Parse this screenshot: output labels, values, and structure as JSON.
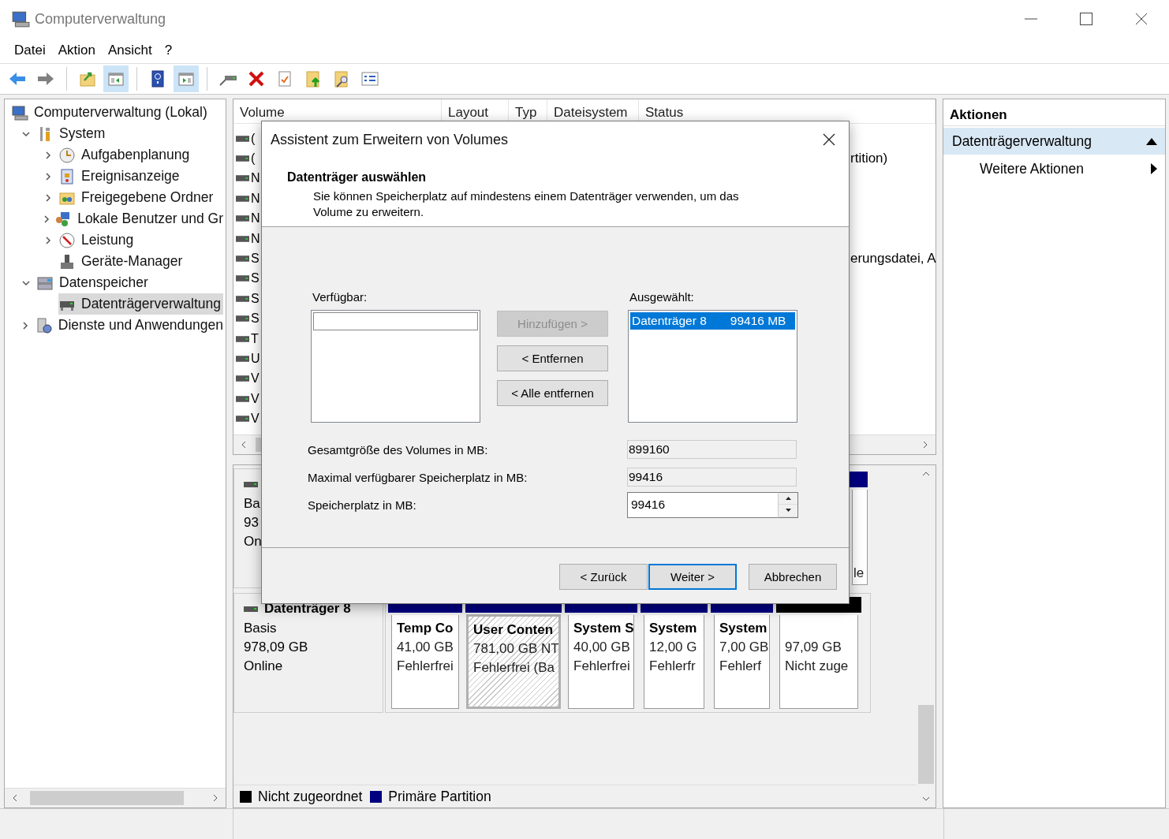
{
  "window": {
    "title": "Computerverwaltung"
  },
  "menu": [
    {
      "label": "Datei"
    },
    {
      "label": "Aktion"
    },
    {
      "label": "Ansicht"
    },
    {
      "label": "?"
    }
  ],
  "toolbar": [
    {
      "pressed": false
    },
    {
      "pressed": false
    },
    {
      "pressed": false
    },
    {
      "pressed": true
    },
    {
      "pressed": false
    },
    {
      "pressed": true
    },
    {
      "pressed": false
    },
    {
      "pressed": false
    },
    {
      "pressed": false
    },
    {
      "pressed": false
    },
    {
      "pressed": false
    },
    {
      "pressed": false
    }
  ],
  "tree": [
    {
      "label": "Computerverwaltung (Lokal)",
      "selected": false,
      "children": [
        {
          "label": "System",
          "expandable": true,
          "expanded": true,
          "selected": false,
          "children": [
            {
              "label": "Aufgabenplanung",
              "expandable": true,
              "expanded": false,
              "selected": false
            },
            {
              "label": "Ereignisanzeige",
              "expandable": true,
              "expanded": false,
              "selected": false
            },
            {
              "label": "Freigegebene Ordner",
              "expandable": true,
              "expanded": false,
              "selected": false
            },
            {
              "label": "Lokale Benutzer und Gr",
              "expandable": true,
              "expanded": false,
              "selected": false
            },
            {
              "label": "Leistung",
              "expandable": true,
              "expanded": false,
              "selected": false
            },
            {
              "label": "Geräte-Manager",
              "expandable": false,
              "selected": false
            }
          ]
        },
        {
          "label": "Datenspeicher",
          "expandable": true,
          "expanded": true,
          "selected": false,
          "children": [
            {
              "label": "Datenträgerverwaltung",
              "expandable": false,
              "selected": true
            }
          ]
        },
        {
          "label": "Dienste und Anwendungen",
          "expandable": true,
          "expanded": false,
          "selected": false
        }
      ]
    }
  ],
  "volume_list": {
    "columns": [
      "Volume",
      "Layout",
      "Typ",
      "Dateisystem",
      "Status"
    ],
    "rows": [
      {
        "volume": "("
      },
      {
        "volume": "(",
        "status": "rtition)"
      },
      {
        "volume": "N"
      },
      {
        "volume": "N"
      },
      {
        "volume": "N"
      },
      {
        "volume": "N"
      },
      {
        "volume": "S",
        "status": "erungsdatei, A"
      },
      {
        "volume": "S"
      },
      {
        "volume": "S"
      },
      {
        "volume": "S"
      },
      {
        "volume": "T"
      },
      {
        "volume": "U"
      },
      {
        "volume": "V"
      },
      {
        "volume": "V"
      },
      {
        "volume": "V"
      }
    ]
  },
  "disks": [
    {
      "info": [
        "Ba",
        "93",
        "On"
      ],
      "partitions": [
        {
          "color": "#000080",
          "selected": false,
          "lines": [
            "le"
          ]
        }
      ]
    },
    {
      "name": "Datenträger 8",
      "info": [
        "Basis",
        "978,09 GB",
        "Online"
      ],
      "partitions": [
        {
          "color": "#000080",
          "selected": false,
          "name": "Temp Co",
          "lines": [
            "41,00 GB",
            "Fehlerfrei"
          ]
        },
        {
          "color": "#000080",
          "selected": true,
          "name": "User Conten",
          "lines": [
            "781,00 GB NT",
            "Fehlerfrei (Ba"
          ]
        },
        {
          "color": "#000080",
          "selected": false,
          "name": "System S",
          "lines": [
            "40,00 GB",
            "Fehlerfrei"
          ]
        },
        {
          "color": "#000080",
          "selected": false,
          "name": "System",
          "lines": [
            "12,00 G",
            "Fehlerfr"
          ]
        },
        {
          "color": "#000080",
          "selected": false,
          "name": "System",
          "lines": [
            "7,00 GB",
            "Fehlerf"
          ]
        },
        {
          "color": "#000000",
          "selected": false,
          "lines": [
            "97,09 GB",
            "Nicht zuge"
          ]
        }
      ]
    }
  ],
  "legend": [
    {
      "label": "Nicht zugeordnet",
      "color": "#000000"
    },
    {
      "label": "Primäre Partition",
      "color": "#000080"
    }
  ],
  "actions": {
    "title": "Aktionen",
    "sections": [
      {
        "label": "Datenträgerverwaltung",
        "expanded": true,
        "items": [
          {
            "label": "Weitere Aktionen"
          }
        ]
      }
    ]
  },
  "dialog": {
    "title": "Assistent zum Erweitern von Volumes",
    "heading": "Datenträger auswählen",
    "description": "Sie können Speicherplatz auf mindestens einem Datenträger verwenden, um das Volume zu erweitern.",
    "available": {
      "label": "Verfügbar:"
    },
    "chosen": {
      "label": "Ausgewählt:",
      "items": [
        {
          "disk": "Datenträger 8",
          "size": "99416 MB",
          "selected": true
        }
      ]
    },
    "move_buttons": [
      {
        "label": "Hinzufügen >",
        "disabled": true
      },
      {
        "label": "< Entfernen",
        "disabled": false
      },
      {
        "label": "< Alle entfernen",
        "disabled": false
      }
    ],
    "fields": [
      {
        "label": "Gesamtgröße des Volumes in MB:",
        "value": "899160",
        "kind": "readonly"
      },
      {
        "label": "Maximal verfügbarer Speicherplatz in MB:",
        "value": "99416",
        "kind": "readonly"
      },
      {
        "label": "Speicherplatz in MB:",
        "value": "99416",
        "kind": "spin"
      }
    ],
    "buttons": [
      {
        "label": "< Zurück",
        "default": false
      },
      {
        "label": "Weiter >",
        "default": true
      },
      {
        "label": "Abbrechen",
        "default": false
      }
    ]
  }
}
